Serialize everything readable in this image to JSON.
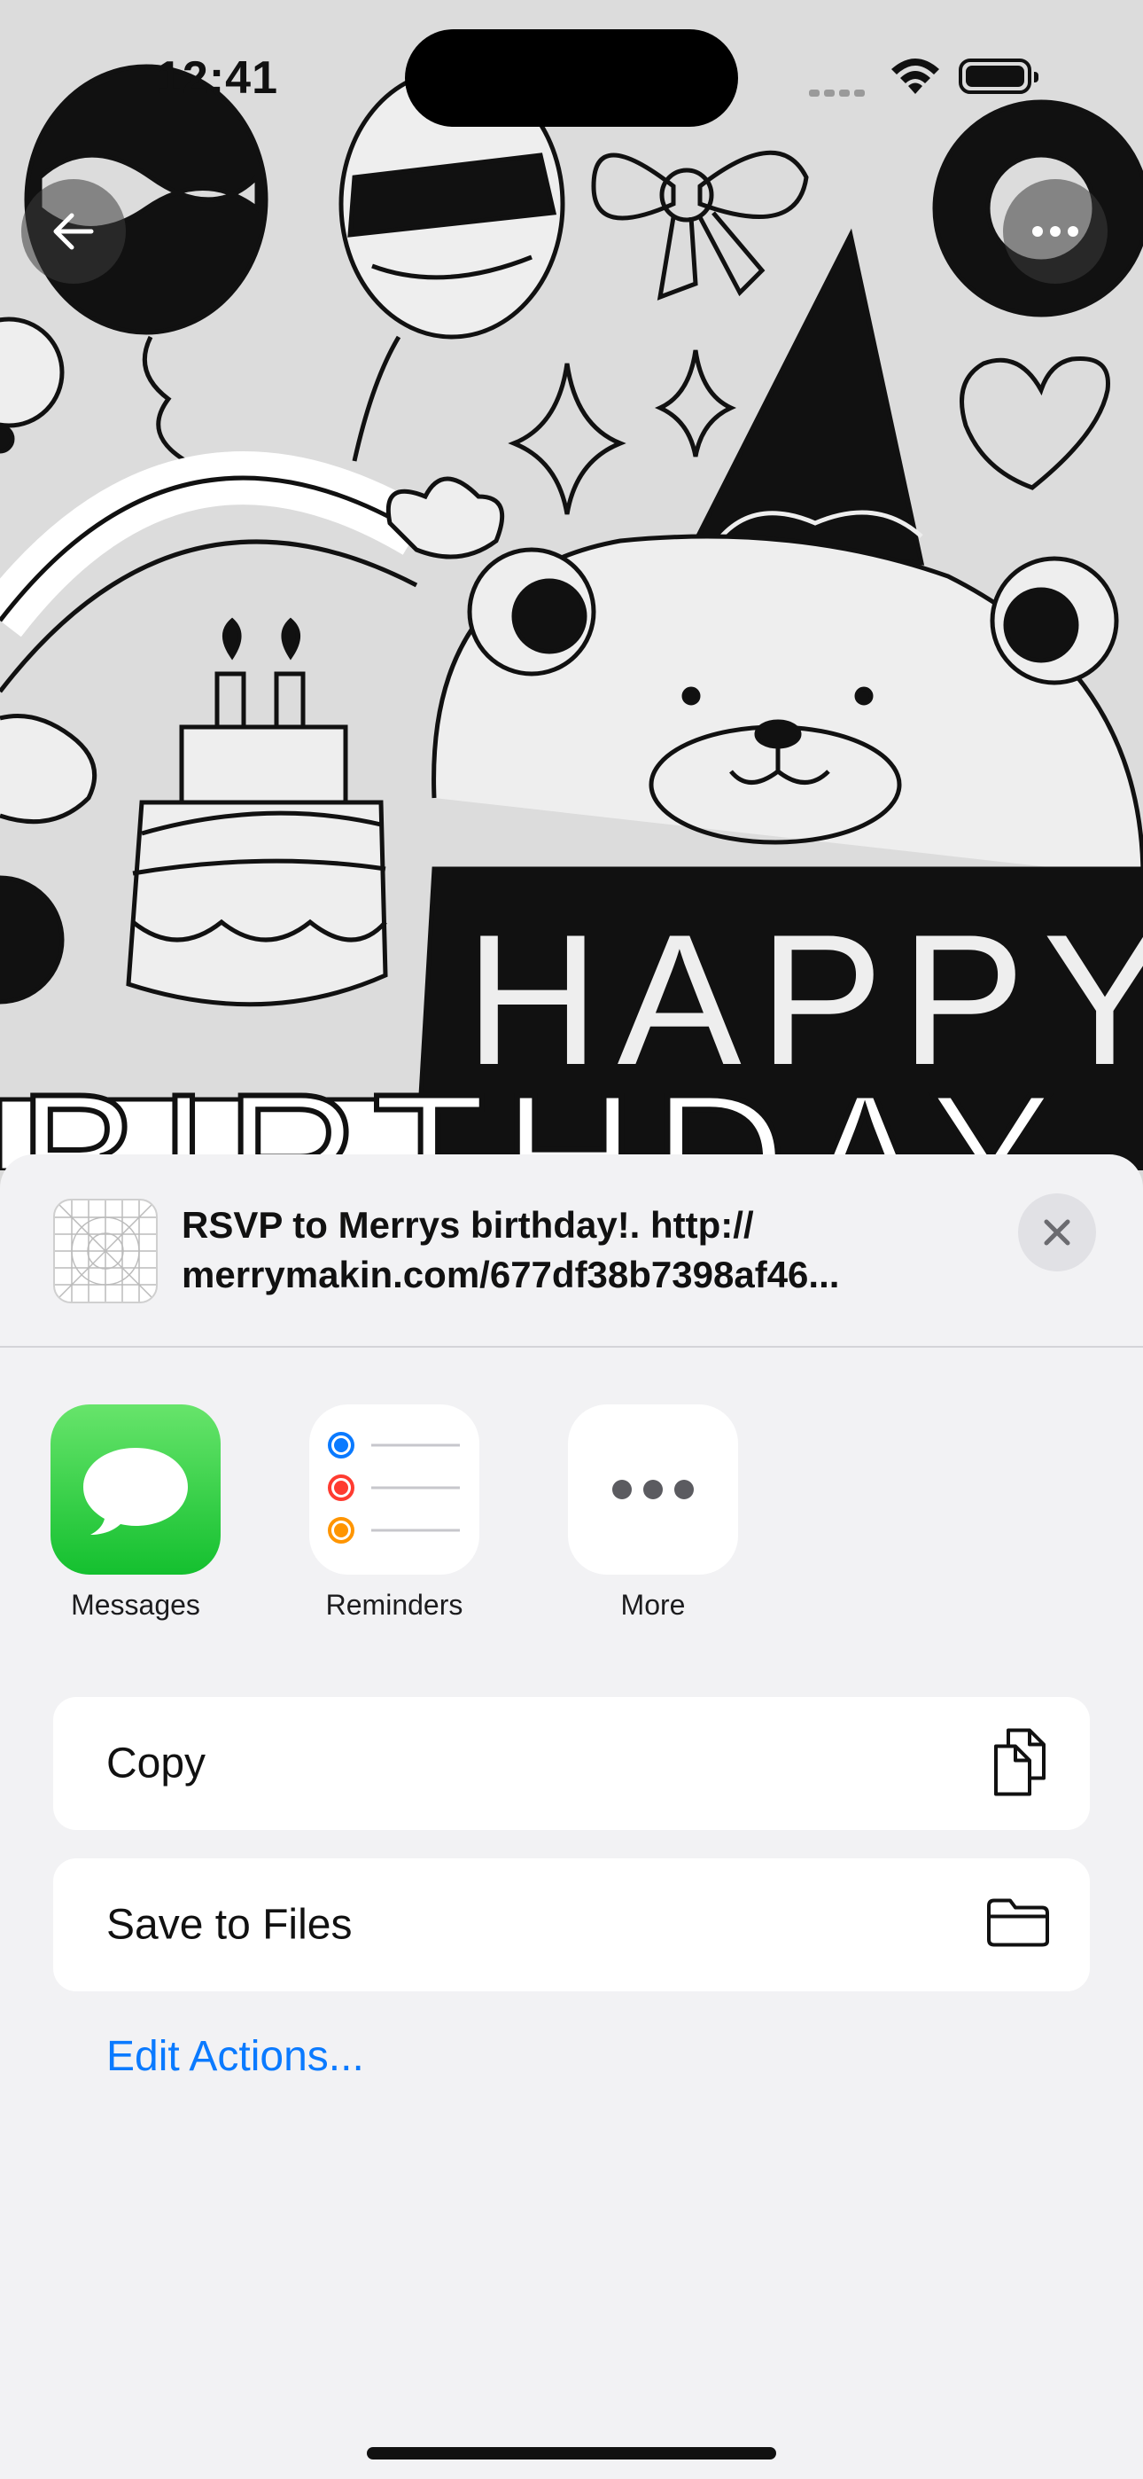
{
  "status_bar": {
    "time": "12:41"
  },
  "header": {
    "back_icon": "arrow-left-icon",
    "more_icon": "ellipsis-icon"
  },
  "background_art": {
    "banner_text_1": "HAPPY",
    "banner_text_2": "BIRTHDAY"
  },
  "share_sheet": {
    "preview_line_1": "RSVP to Merrys birthday!. http://",
    "preview_line_2": "merrymakin.com/677df38b7398af46...",
    "close_icon": "xmark-icon",
    "apps": [
      {
        "label": "Messages",
        "icon": "messages-icon"
      },
      {
        "label": "Reminders",
        "icon": "reminders-icon"
      },
      {
        "label": "More",
        "icon": "ellipsis-icon"
      }
    ],
    "actions": [
      {
        "label": "Copy",
        "icon": "copy-icon"
      },
      {
        "label": "Save to Files",
        "icon": "folder-icon"
      }
    ],
    "edit_actions_label": "Edit Actions..."
  },
  "colors": {
    "accent": "#0a7aff",
    "messages_green": "#28c840",
    "sheet_bg": "#f2f2f4"
  }
}
